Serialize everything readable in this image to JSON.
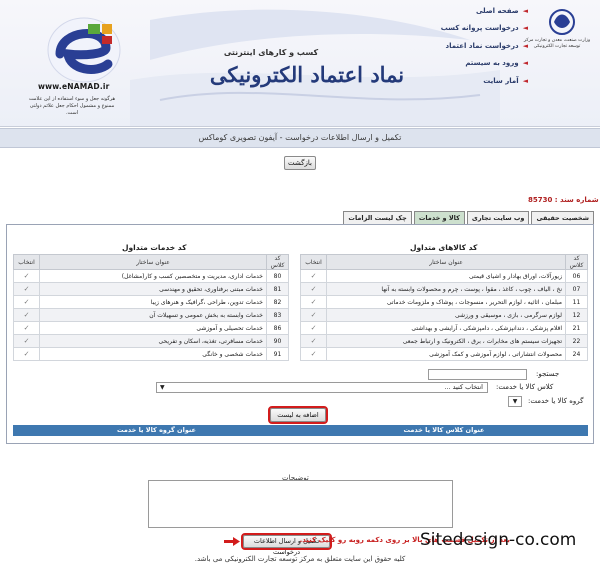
{
  "header": {
    "brand_url": "www.eNAMAD.ir",
    "brand_notice": "هرگونه جعل و سوء استفاده از این علامت ممنوع و مشمول احکام جعل علائم دولتی است.",
    "title_sub": "کسب و کارهای اینترنتی",
    "title_main": "نماد اعتماد الکترونیکی",
    "menu": [
      {
        "label": "صفحه اصلی"
      },
      {
        "label": "درخواست پروانه کسب"
      },
      {
        "label": "درخواست نماد اعتماد"
      },
      {
        "label": "ورود به سیستم"
      },
      {
        "label": "آمار سایت"
      }
    ],
    "seal_text": "وزارت صنعت، معدن و تجارت مرکز توسعه تجارت الکترونیکی"
  },
  "infobar": {
    "text": "تکمیل و ارسال اطلاعات درخواست - آیفون تصویری کوماکس"
  },
  "buttons": {
    "back": "بازگشت",
    "add_to_list": "اضافه به لیست",
    "submit": "تکمیل و ارسال اطلاعات درخواست"
  },
  "request": {
    "label": "شماره سند :",
    "number": "85730"
  },
  "tabs": [
    {
      "label": "شخصیت حقیقی",
      "active": false
    },
    {
      "label": "وب سایت تجاری",
      "active": false
    },
    {
      "label": "کالا و خدمات",
      "active": true
    },
    {
      "label": "چک لیست الزامات",
      "active": false
    }
  ],
  "goods_section": {
    "title": "کد کالاهای متداول",
    "columns": [
      "کد کلاس",
      "عنوان ساختار",
      "انتخاب"
    ],
    "rows": [
      {
        "code": "06",
        "title": "زیورآلات، اوراق بهادار و اشیای قیمتی"
      },
      {
        "code": "07",
        "title": "نخ ، الیاف ، چوب ، کاغذ ، مقوا ، پوست ، چرم و محصولات وابسته به آنها"
      },
      {
        "code": "11",
        "title": "مبلمان ، اثاثیه ، لوازم التحریر ، منسوجات ، پوشاک و ملزومات خدماتی"
      },
      {
        "code": "12",
        "title": "لوازم سرگرمی ، بازی ، موسیقی و ورزشی"
      },
      {
        "code": "21",
        "title": "اقلام پزشکی ، دندانپزشکی ، دامپزشکی ، آرایشی و بهداشتی"
      },
      {
        "code": "22",
        "title": "تجهیزات سیستم های مخابرات ، برق ، الکترونیک و ارتباط جمعی"
      },
      {
        "code": "24",
        "title": "محصولات انتشاراتی ، لوازم آموزشی و کمک آموزشی"
      }
    ]
  },
  "services_section": {
    "title": "کد خدمات متداول",
    "columns": [
      "کد کلاس",
      "عنوان ساختار",
      "انتخاب"
    ],
    "rows": [
      {
        "code": "80",
        "title": "خدمات اداری، مدیریت و متخصصین کسب و کار(مشاغل)"
      },
      {
        "code": "81",
        "title": "خدمات مبتنی برفناوری، تحقیق و مهندسی"
      },
      {
        "code": "82",
        "title": "خدمات تدوین، طراحی ،گرافیک و هنرهای زیبا"
      },
      {
        "code": "83",
        "title": "خدمات وابسته به بخش عمومی و تسهیلات آن"
      },
      {
        "code": "86",
        "title": "خدمات تحصیلی و آموزشی"
      },
      {
        "code": "90",
        "title": "خدمات مسافرتی، تغذیه، اسکان و تفریحی"
      },
      {
        "code": "91",
        "title": "خدمات شخصی و خانگی"
      }
    ]
  },
  "filters": {
    "search_label": "جستجو:",
    "class_label": "کلاس کالا یا خدمت:",
    "class_value": "انتخاب کنید ...",
    "group_label": "گروه کالا یا خدمت:"
  },
  "result_table": {
    "col_right": "عنوان کلاس کالا یا خدمت",
    "col_left": "عنوان گروه کالا یا خدمت"
  },
  "description": {
    "label": "توضیحات"
  },
  "hint": "بعد از تکمیل قسمت های بالا بر روی دکمه روبه رو کلیک کنید.",
  "watermark": "Sitedesign-co.com",
  "footer": "کلیه حقوق این سایت متعلق به مرکز توسعه تجارت الکترونیکی می باشد.",
  "colors": {
    "accent_blue": "#3e78b0",
    "title_blue": "#243a7a",
    "alert_red": "#d21c1c",
    "active_tab": "#cde0ce"
  },
  "icons": {
    "check": "✓",
    "menu_arrow": "◄",
    "dropdown": "▼"
  }
}
